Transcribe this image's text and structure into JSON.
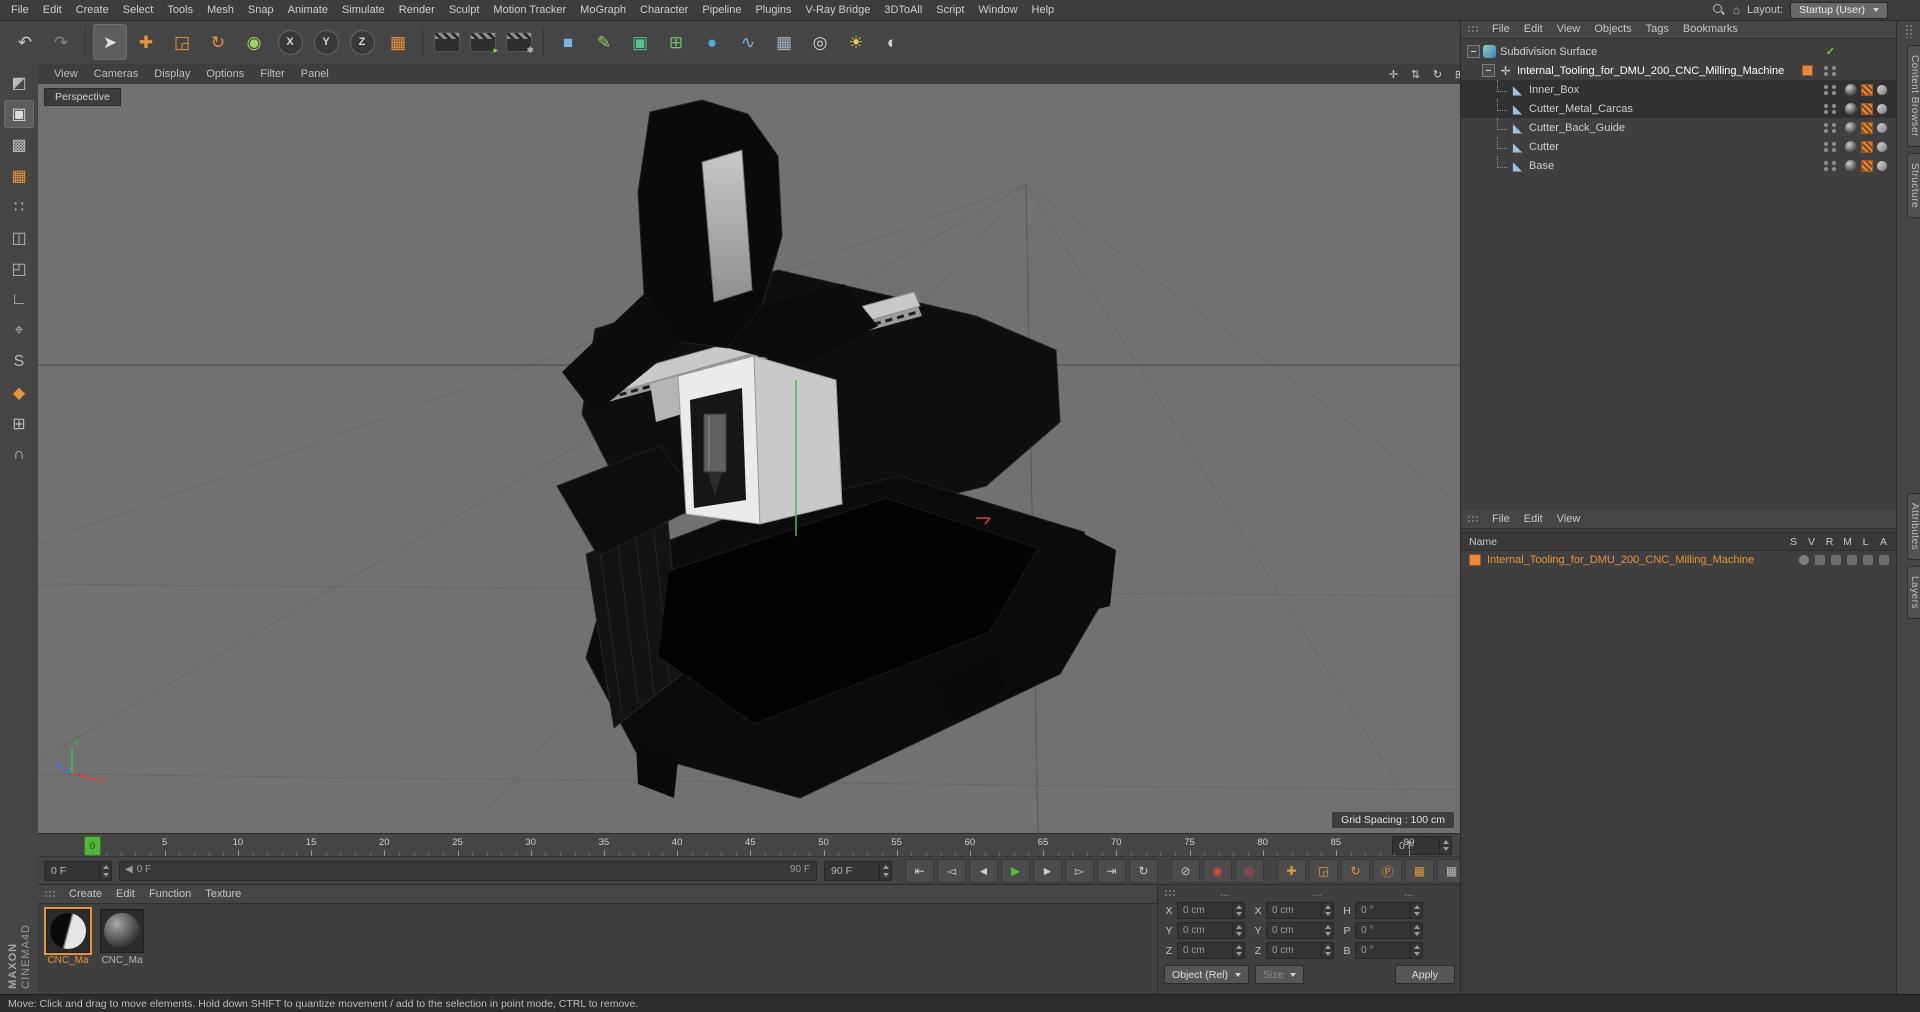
{
  "menubar": {
    "items": [
      "File",
      "Edit",
      "Create",
      "Select",
      "Tools",
      "Mesh",
      "Snap",
      "Animate",
      "Simulate",
      "Render",
      "Sculpt",
      "Motion Tracker",
      "MoGraph",
      "Character",
      "Pipeline",
      "Plugins",
      "V-Ray Bridge",
      "3DToAll",
      "Script",
      "Window",
      "Help"
    ],
    "layout_label": "Layout:",
    "layout_value": "Startup (User)"
  },
  "toolbar": {
    "icons": [
      {
        "name": "undo",
        "glyph": "↶",
        "color": "#c9c9c9"
      },
      {
        "name": "redo",
        "glyph": "↷",
        "color": "#858585"
      },
      {
        "sep": true
      },
      {
        "name": "live-selection",
        "glyph": "➤",
        "color": "#e2e2e2",
        "selected": true
      },
      {
        "name": "move-tool",
        "glyph": "✚",
        "color": "#e8943a"
      },
      {
        "name": "scale-tool",
        "glyph": "◲",
        "color": "#e8943a"
      },
      {
        "name": "rotate-tool",
        "glyph": "↻",
        "color": "#e8943a"
      },
      {
        "name": "last-used-tool",
        "glyph": "◉",
        "color": "#9fd468"
      },
      {
        "name": "x-axis-lock",
        "glyph": "X",
        "circle": true
      },
      {
        "name": "y-axis-lock",
        "glyph": "Y",
        "circle": true
      },
      {
        "name": "z-axis-lock",
        "glyph": "Z",
        "circle": true
      },
      {
        "name": "coordinate-system",
        "glyph": "▦",
        "color": "#e8943a"
      },
      {
        "sep": true
      },
      {
        "name": "render-view",
        "clapper": true
      },
      {
        "name": "render-picture-viewer",
        "clapper": true,
        "badge": "▸",
        "color": "#9fd468"
      },
      {
        "name": "render-settings",
        "clapper": true,
        "badge": "✱",
        "color": "#b5b5b5"
      },
      {
        "sep": true
      },
      {
        "name": "primitive-cube",
        "glyph": "■",
        "color": "#7ab4e0"
      },
      {
        "name": "pen-tool",
        "glyph": "✎",
        "color": "#8fd05a"
      },
      {
        "name": "subdivision-surface-tool",
        "glyph": "▣",
        "color": "#58c48a"
      },
      {
        "name": "mograph-cloner",
        "glyph": "⊞",
        "color": "#6fc06f"
      },
      {
        "name": "simulation",
        "glyph": "●",
        "color": "#5aa8d8"
      },
      {
        "name": "spline-tool",
        "glyph": "∿",
        "color": "#7ab4e0"
      },
      {
        "name": "workplane-grid",
        "glyph": "▦",
        "color": "#9fb7c8"
      },
      {
        "name": "camera",
        "glyph": "◎",
        "color": "#d2d2d2"
      },
      {
        "name": "light",
        "glyph": "☀",
        "color": "#e8d25a"
      },
      {
        "name": "display-mode",
        "glyph": "◐",
        "color": "#d2d2d2"
      }
    ]
  },
  "sidebar": {
    "icons": [
      {
        "name": "make-editable",
        "glyph": "◩",
        "color": "#b9b9b9"
      },
      {
        "name": "model-mode",
        "glyph": "▣",
        "color": "#dcdcdc",
        "selected": true
      },
      {
        "name": "texture-mode",
        "glyph": "▩",
        "color": "#b9b9b9"
      },
      {
        "name": "workplane-mode",
        "glyph": "▦",
        "color": "#e8943a"
      },
      {
        "name": "points-mode",
        "glyph": "∷",
        "color": "#b9b9b9"
      },
      {
        "name": "edges-mode",
        "glyph": "◫",
        "color": "#b9b9b9"
      },
      {
        "name": "polygons-mode",
        "glyph": "◰",
        "color": "#b9b9b9"
      },
      {
        "name": "axis-mode",
        "glyph": "∟",
        "color": "#b9b9b9"
      },
      {
        "name": "viewport-solo",
        "glyph": "⌖",
        "color": "#b9b9b9"
      },
      {
        "name": "snap-mode",
        "glyph": "S",
        "color": "#b9b9b9"
      },
      {
        "name": "paint-tool",
        "glyph": "◆",
        "color": "#e8943a"
      },
      {
        "name": "lock-workplane",
        "glyph": "⊞",
        "color": "#b9b9b9"
      },
      {
        "name": "magnet-snap",
        "glyph": "∩",
        "color": "#b9b9b9"
      }
    ]
  },
  "branding": {
    "maxon": "MAXON",
    "cinema": "CINEMA4D"
  },
  "viewport": {
    "menus": [
      "View",
      "Cameras",
      "Display",
      "Options",
      "Filter",
      "Panel"
    ],
    "view_controls": [
      {
        "name": "pan-view",
        "glyph": "✛"
      },
      {
        "name": "zoom-view",
        "glyph": "⇅"
      },
      {
        "name": "rotate-view",
        "glyph": "↻"
      },
      {
        "name": "toggle-layout",
        "glyph": "⊞"
      }
    ],
    "camera_label": "Perspective",
    "grid_spacing": "Grid Spacing : 100 cm"
  },
  "object_manager": {
    "menus": [
      "File",
      "Edit",
      "View",
      "Objects",
      "Tags",
      "Bookmarks"
    ],
    "rows": [
      {
        "label": "Subdivision Surface",
        "depth": 0,
        "icon": "subdivision-surface",
        "expander": true,
        "check": true
      },
      {
        "label": "Internal_Tooling_for_DMU_200_CNC_Milling_Machine",
        "depth": 1,
        "icon": "null-object",
        "expander": true,
        "chip": true,
        "dots": true,
        "white": true
      },
      {
        "label": "Inner_Box",
        "depth": 2,
        "icon": "polygon-object",
        "connector": true,
        "selected": true,
        "dots": true,
        "material": true,
        "texture": true,
        "phong": true
      },
      {
        "label": "Cutter_Metal_Carcas",
        "depth": 2,
        "icon": "polygon-object",
        "connector": true,
        "selected": true,
        "dots": true,
        "material": true,
        "texture": true,
        "phong": true
      },
      {
        "label": "Cutter_Back_Guide",
        "depth": 2,
        "icon": "polygon-object",
        "connector": true,
        "dots": true,
        "material": true,
        "texture": true,
        "phong": true
      },
      {
        "label": "Cutter",
        "depth": 2,
        "icon": "polygon-object",
        "connector": true,
        "dots": true,
        "material": true,
        "texture": true,
        "phong": true
      },
      {
        "label": "Base",
        "depth": 2,
        "icon": "polygon-object",
        "connector": true,
        "dots": true,
        "material": true,
        "texture": true,
        "phong": true
      }
    ]
  },
  "layer_manager": {
    "menus": [
      "File",
      "Edit",
      "View"
    ],
    "name_header": "Name",
    "columns": [
      "S",
      "V",
      "R",
      "M",
      "L",
      "A"
    ],
    "row_label": "Internal_Tooling_for_DMU_200_CNC_Milling_Machine",
    "row_icons": [
      "solo",
      "view",
      "render",
      "manager",
      "lock",
      "animate"
    ]
  },
  "timeline": {
    "labels": [
      "0",
      "5",
      "10",
      "15",
      "20",
      "25",
      "30",
      "35",
      "40",
      "45",
      "50",
      "55",
      "60",
      "65",
      "70",
      "75",
      "80",
      "85",
      "90"
    ],
    "marker_frame": "0",
    "frame_field": "0 F"
  },
  "transport": {
    "current_frame": "0 F",
    "range_marker": "◀",
    "range_start": "0 F",
    "range_end": "90 F",
    "end_frame": "90 F",
    "buttons": [
      {
        "name": "go-to-start",
        "glyph": "⇤"
      },
      {
        "name": "previous-key",
        "glyph": "◅"
      },
      {
        "name": "previous-frame",
        "glyph": "◄"
      },
      {
        "name": "play",
        "glyph": "►",
        "color": "#52c234"
      },
      {
        "name": "next-frame",
        "glyph": "►"
      },
      {
        "name": "next-key",
        "glyph": "▻"
      },
      {
        "name": "go-to-end",
        "glyph": "⇥"
      },
      {
        "name": "loop",
        "glyph": "↻"
      }
    ],
    "record_buttons": [
      {
        "name": "record-objects",
        "glyph": "⊘",
        "color": "#c2c2c2"
      },
      {
        "name": "autokeying",
        "glyph": "◉",
        "color": "#d84a3a"
      },
      {
        "name": "keying-settings",
        "glyph": "◎",
        "color": "#d84a3a"
      }
    ],
    "key_toggles": [
      {
        "name": "key-position",
        "glyph": "✚",
        "color": "#e8943a"
      },
      {
        "name": "key-scale",
        "glyph": "◲",
        "color": "#e8943a"
      },
      {
        "name": "key-rotation",
        "glyph": "↻",
        "color": "#e8943a"
      },
      {
        "name": "key-parameter",
        "glyph": "Ⓟ",
        "color": "#e8943a"
      },
      {
        "name": "key-pla",
        "glyph": "▦",
        "color": "#e8943a"
      },
      {
        "name": "keyframe-selection",
        "glyph": "▦",
        "color": "#b9b9b9"
      }
    ]
  },
  "materials": {
    "menus": [
      "Create",
      "Edit",
      "Function",
      "Texture"
    ],
    "items": [
      {
        "label": "CNC_Ma",
        "selected": true
      },
      {
        "label": "CNC_Ma",
        "selected": false
      }
    ]
  },
  "coordinates": {
    "headers": [
      "…",
      "…",
      "…"
    ],
    "groups": [
      {
        "rows": [
          {
            "label": "X",
            "value": "0 cm"
          },
          {
            "label": "Y",
            "value": "0 cm"
          },
          {
            "label": "Z",
            "value": "0 cm"
          }
        ]
      },
      {
        "rows": [
          {
            "label": "X",
            "value": "0 cm"
          },
          {
            "label": "Y",
            "value": "0 cm"
          },
          {
            "label": "Z",
            "value": "0 cm"
          }
        ]
      },
      {
        "rows": [
          {
            "label": "H",
            "value": "0 °"
          },
          {
            "label": "P",
            "value": "0 °"
          },
          {
            "label": "B",
            "value": "0 °"
          }
        ]
      }
    ],
    "mode_object": "Object (Rel)",
    "mode_size": "Size",
    "apply_label": "Apply"
  },
  "edge_tabs": {
    "top": [
      "Content Browser",
      "Structure"
    ],
    "bottom": [
      "Attributes",
      "Layers"
    ]
  },
  "statusbar": {
    "text": "Move: Click and drag to move elements. Hold down SHIFT to quantize movement / add to the selection in point mode, CTRL to remove."
  },
  "colors": {
    "accent": "#e8943a",
    "play_green": "#52c234",
    "marker_green": "#52b43a",
    "record_red": "#d84a3a"
  }
}
